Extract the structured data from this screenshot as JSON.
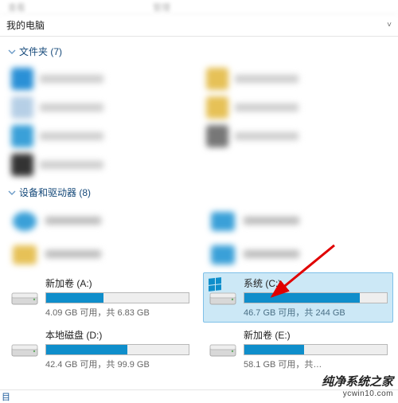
{
  "toolbar": {
    "left": "查看",
    "right": "管理"
  },
  "address": {
    "title": "我的电脑",
    "chev": "˅"
  },
  "sections": {
    "folders": {
      "label": "文件夹 (7)"
    },
    "drives": {
      "label": "设备和驱动器 (8)"
    }
  },
  "drive_a": {
    "name": "新加卷 (A:)",
    "info": "4.09 GB 可用，共 6.83 GB",
    "fill_pct": 40
  },
  "drive_c": {
    "name": "系统 (C:)",
    "info": "46.7 GB 可用，共 244 GB",
    "fill_pct": 81
  },
  "drive_d": {
    "name": "本地磁盘 (D:)",
    "info": "42.4 GB 可用，共 99.9 GB",
    "fill_pct": 57
  },
  "drive_e": {
    "name": "新加卷 (E:)",
    "info": "58.1 GB 可用，共…",
    "fill_pct": 42
  },
  "watermark": {
    "main": "纯净系统之家",
    "sub": "ycwin10.com"
  },
  "corner": "目"
}
